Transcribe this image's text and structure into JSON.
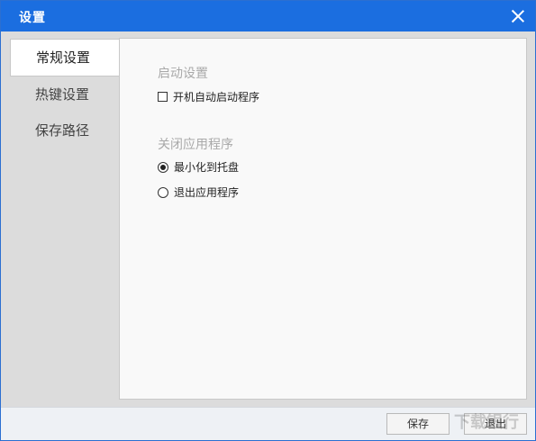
{
  "window": {
    "title": "设置"
  },
  "sidebar": {
    "items": [
      {
        "label": "常规设置"
      },
      {
        "label": "热键设置"
      },
      {
        "label": "保存路径"
      }
    ]
  },
  "startup": {
    "title": "启动设置",
    "autostart_label": "开机自动启动程序"
  },
  "close_app": {
    "title": "关闭应用程序",
    "options": [
      {
        "label": "最小化到托盘"
      },
      {
        "label": "退出应用程序"
      }
    ]
  },
  "footer": {
    "save_label": "保存",
    "exit_label": "退出"
  },
  "watermark": {
    "text": "下载银行",
    "url": "www.downbank.cn"
  }
}
